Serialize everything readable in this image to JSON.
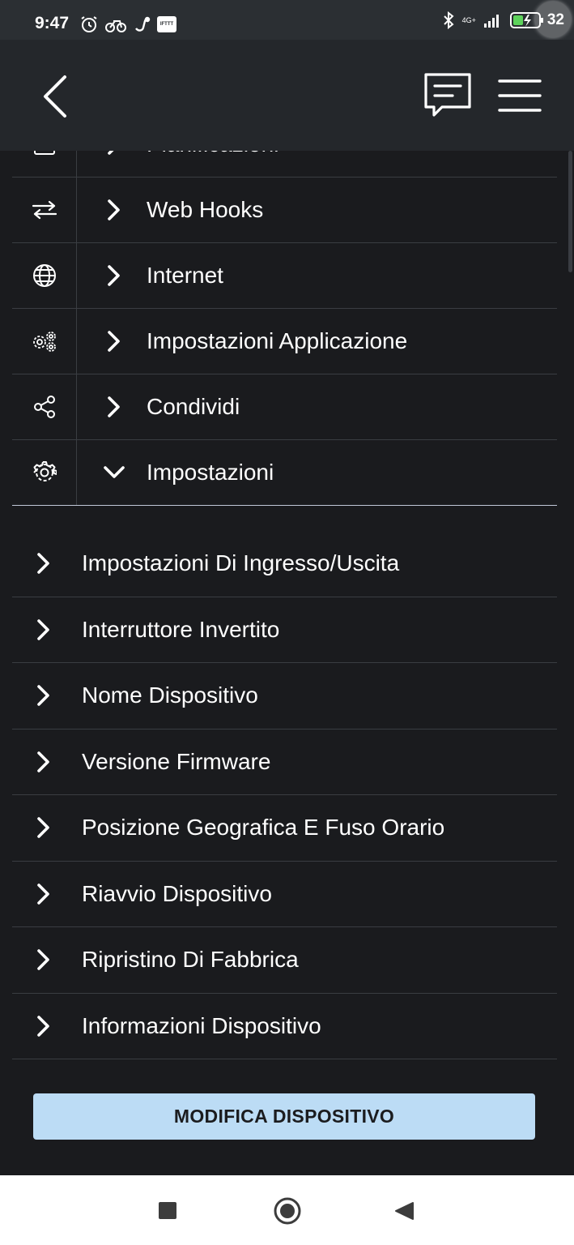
{
  "status_bar": {
    "time": "9:47",
    "network": "4G+",
    "battery": "32"
  },
  "header": {
    "back_icon": "chevron-left-icon",
    "chat_icon": "message-icon",
    "menu_icon": "hamburger-icon"
  },
  "menu": {
    "partial_item": "Pianificazioni",
    "items": [
      {
        "label": "Web Hooks",
        "icon": "swap-arrows-icon"
      },
      {
        "label": "Internet",
        "icon": "globe-icon"
      },
      {
        "label": "Impostazioni Applicazione",
        "icon": "gears-icon"
      },
      {
        "label": "Condividi",
        "icon": "share-icon"
      },
      {
        "label": "Impostazioni",
        "icon": "gear-icon",
        "expanded": true
      }
    ]
  },
  "settings": {
    "items": [
      "Impostazioni Di Ingresso/Uscita",
      "Interruttore Invertito",
      "Nome Dispositivo",
      "Versione Firmware",
      "Posizione Geografica E Fuso Orario",
      "Riavvio Dispositivo",
      "Ripristino Di Fabbrica",
      "Informazioni Dispositivo"
    ]
  },
  "actions": {
    "edit_device": "MODIFICA DISPOSITIVO"
  },
  "colors": {
    "background": "#1a1b1e",
    "header": "#24272b",
    "button": "#bcdcf5"
  }
}
